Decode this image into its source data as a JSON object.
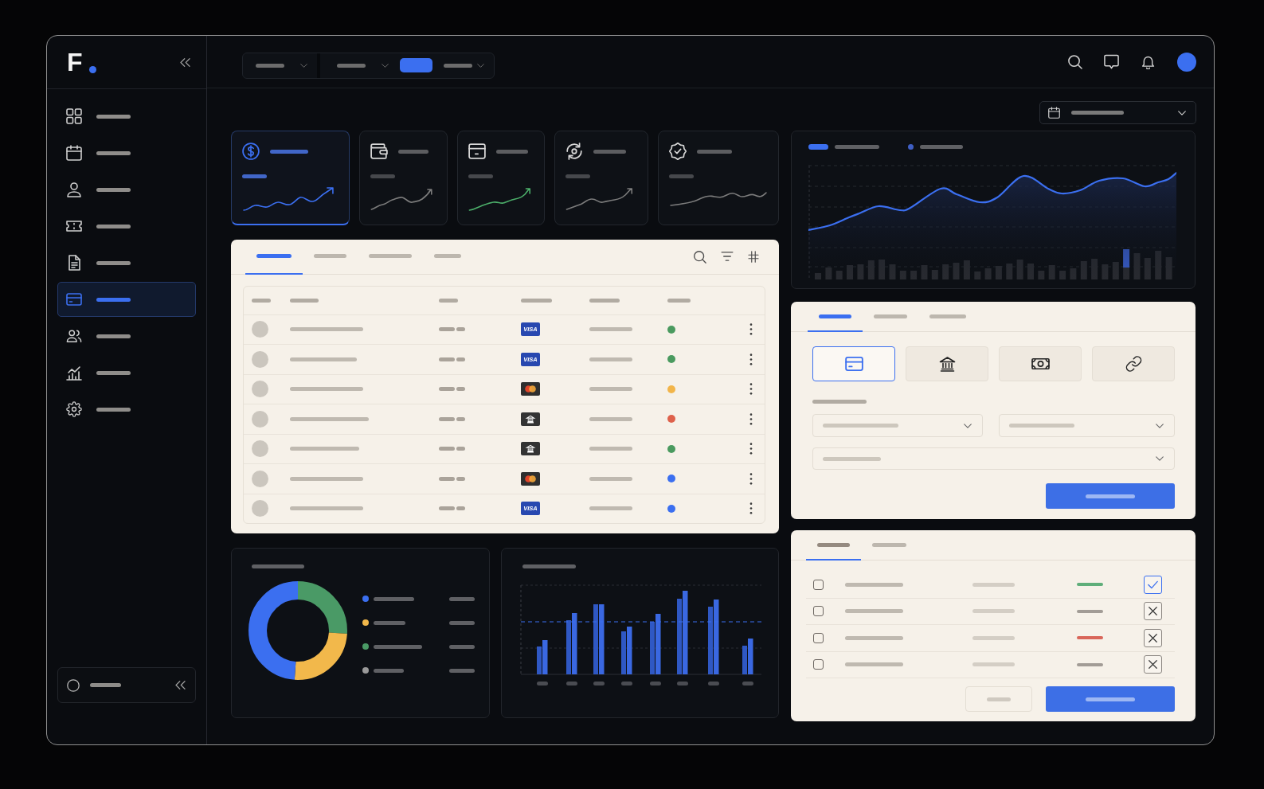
{
  "sidebar": {
    "logo": {
      "text": "F"
    },
    "items": [
      {
        "selected": false
      },
      {
        "selected": false
      },
      {
        "selected": false
      },
      {
        "selected": false
      },
      {
        "selected": false
      },
      {
        "selected": true
      },
      {
        "selected": false
      },
      {
        "selected": false
      },
      {
        "selected": false
      }
    ]
  },
  "topbar": {
    "filters": [
      {
        "selected": false
      },
      {
        "selected": false
      },
      {
        "selected": true
      },
      {
        "selected": false
      }
    ]
  },
  "stats": [
    {
      "selected": true,
      "color": "#3b6ff0"
    },
    {
      "selected": false,
      "color": "#7c7c7c"
    },
    {
      "selected": false,
      "color": "#4caf6a"
    },
    {
      "selected": false,
      "color": "#7c7c7c"
    },
    {
      "selected": false,
      "color": "#7c7c7c"
    }
  ],
  "transactions": {
    "tabs": [
      {
        "selected": true
      },
      {
        "selected": false
      },
      {
        "selected": false
      },
      {
        "selected": false
      }
    ],
    "rows": [
      {
        "method": {
          "kind": "text",
          "text": "VISA"
        },
        "color": "#4a9a5f"
      },
      {
        "method": {
          "kind": "text",
          "text": "VISA"
        },
        "color": "#4a9a5f"
      },
      {
        "method": {
          "kind": "circles"
        },
        "color": "#f2b54a"
      },
      {
        "method": {
          "kind": "bank"
        },
        "color": "#de614b"
      },
      {
        "method": {
          "kind": "bank"
        },
        "color": "#4a9a5f"
      },
      {
        "method": {
          "kind": "circles"
        },
        "color": "#3b6ff0"
      },
      {
        "method": {
          "kind": "text",
          "text": "VISA"
        },
        "color": "#3b6ff0"
      }
    ]
  },
  "donut_chart": {
    "legend": [
      {
        "color": "#3b6ff0"
      },
      {
        "color": "#f2b84b"
      },
      {
        "color": "#4a9a66"
      },
      {
        "color": "#9a9a9a"
      }
    ]
  },
  "trend_chart": {
    "legend": [
      {
        "kind": "line",
        "color": "#3b6ff0"
      },
      {
        "kind": "dot",
        "color": "#3f5fc4"
      }
    ]
  },
  "payment": {
    "tabs": [
      {
        "selected": true
      },
      {
        "selected": false
      },
      {
        "selected": false
      }
    ],
    "methods": [
      {
        "selected": true
      },
      {
        "selected": false
      },
      {
        "selected": false
      },
      {
        "selected": false
      }
    ]
  },
  "approvals": {
    "tabs": [
      {
        "selected": true
      },
      {
        "selected": false
      }
    ],
    "rows": [
      {
        "checked": false,
        "color": "#5fae7a",
        "approved": true
      },
      {
        "checked": false,
        "color": "#a29c96",
        "approved": false
      },
      {
        "checked": false,
        "color": "#d9665a",
        "approved": false
      },
      {
        "checked": false,
        "color": "#a29c96",
        "approved": false
      }
    ]
  }
}
